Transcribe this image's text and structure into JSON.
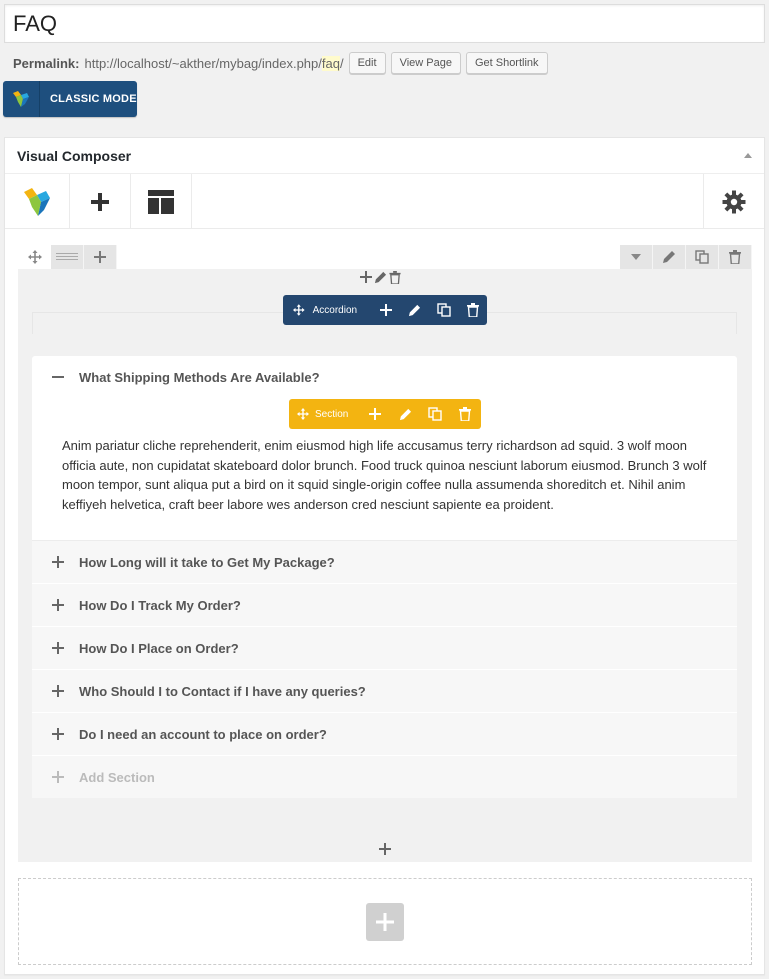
{
  "page": {
    "title": "FAQ",
    "permalink_label": "Permalink:",
    "permalink_base": "http://localhost/~akther/mybag/index.php/",
    "permalink_slug": "faq",
    "permalink_tail": "/",
    "edit_label": "Edit",
    "view_page_label": "View Page",
    "shortlink_label": "Get Shortlink",
    "classic_mode_label": "CLASSIC MODE"
  },
  "composer": {
    "title": "Visual Composer",
    "accordion_label": "Accordion",
    "section_label": "Section",
    "sections": [
      {
        "title": "What Shipping Methods Are Available?",
        "open": true,
        "content": "Anim pariatur cliche reprehenderit, enim eiusmod high life accusamus terry richardson ad squid. 3 wolf moon officia aute, non cupidatat skateboard dolor brunch. Food truck quinoa nesciunt laborum eiusmod. Brunch 3 wolf moon tempor, sunt aliqua put a bird on it squid single-origin coffee nulla assumenda shoreditch et. Nihil anim keffiyeh helvetica, craft beer labore wes anderson cred nesciunt sapiente ea proident."
      },
      {
        "title": "How Long will it take to Get My Package?",
        "open": false
      },
      {
        "title": "How Do I Track My Order?",
        "open": false
      },
      {
        "title": "How Do I Place on Order?",
        "open": false
      },
      {
        "title": "Who Should I to Contact if I have any queries?",
        "open": false
      },
      {
        "title": "Do I need an account to place on order?",
        "open": false
      }
    ],
    "add_section_label": "Add Section"
  },
  "colors": {
    "accordion_bar": "#24476f",
    "section_bar": "#f3b411",
    "classic_button": "#1e4f7e"
  }
}
